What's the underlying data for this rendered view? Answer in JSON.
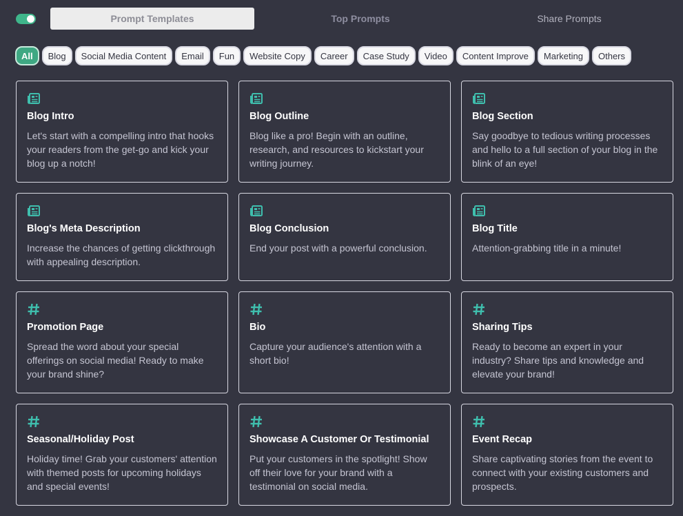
{
  "header": {
    "tabs": [
      {
        "label": "Prompt Templates",
        "active": true
      },
      {
        "label": "Top Prompts",
        "active": false
      },
      {
        "label": "Share Prompts",
        "active": false
      }
    ],
    "toggle_on": true
  },
  "filters": [
    {
      "label": "All",
      "active": true
    },
    {
      "label": "Blog"
    },
    {
      "label": "Social Media Content"
    },
    {
      "label": "Email"
    },
    {
      "label": "Fun"
    },
    {
      "label": "Website Copy"
    },
    {
      "label": "Career"
    },
    {
      "label": "Case Study"
    },
    {
      "label": "Video"
    },
    {
      "label": "Content Improve"
    },
    {
      "label": "Marketing"
    },
    {
      "label": "Others"
    }
  ],
  "colors": {
    "accent": "#3fa883",
    "icon": "#3fbfae",
    "background": "#343541"
  },
  "cards": [
    {
      "icon": "newspaper-icon",
      "title": "Blog Intro",
      "desc": "Let's start with a compelling intro that hooks your readers from the get-go and kick your blog up a notch!"
    },
    {
      "icon": "newspaper-icon",
      "title": "Blog Outline",
      "desc": "Blog like a pro! Begin with an outline, research, and resources to kickstart your writing journey."
    },
    {
      "icon": "newspaper-icon",
      "title": "Blog Section",
      "desc": "Say goodbye to tedious writing processes and hello to a full section of your blog in the blink of an eye!"
    },
    {
      "icon": "newspaper-icon",
      "title": "Blog's Meta Description",
      "desc": "Increase the chances of getting clickthrough with appealing description."
    },
    {
      "icon": "newspaper-icon",
      "title": "Blog Conclusion",
      "desc": "End your post with a powerful conclusion."
    },
    {
      "icon": "newspaper-icon",
      "title": "Blog Title",
      "desc": "Attention-grabbing title in a minute!"
    },
    {
      "icon": "hashtag-icon",
      "title": "Promotion Page",
      "desc": "Spread the word about your special offerings on social media! Ready to make your brand shine?"
    },
    {
      "icon": "hashtag-icon",
      "title": "Bio",
      "desc": "Capture your audience's attention with a short bio!"
    },
    {
      "icon": "hashtag-icon",
      "title": "Sharing Tips",
      "desc": "Ready to become an expert in your industry? Share tips and knowledge and elevate your brand!"
    },
    {
      "icon": "hashtag-icon",
      "title": "Seasonal/Holiday Post",
      "desc": "Holiday time! Grab your customers' attention with themed posts for upcoming holidays and special events!"
    },
    {
      "icon": "hashtag-icon",
      "title": "Showcase A Customer Or Testimonial",
      "desc": "Put your customers in the spotlight! Show off their love for your brand with a testimonial on social media."
    },
    {
      "icon": "hashtag-icon",
      "title": "Event Recap",
      "desc": "Share captivating stories from the event to connect with your existing customers and prospects."
    }
  ]
}
